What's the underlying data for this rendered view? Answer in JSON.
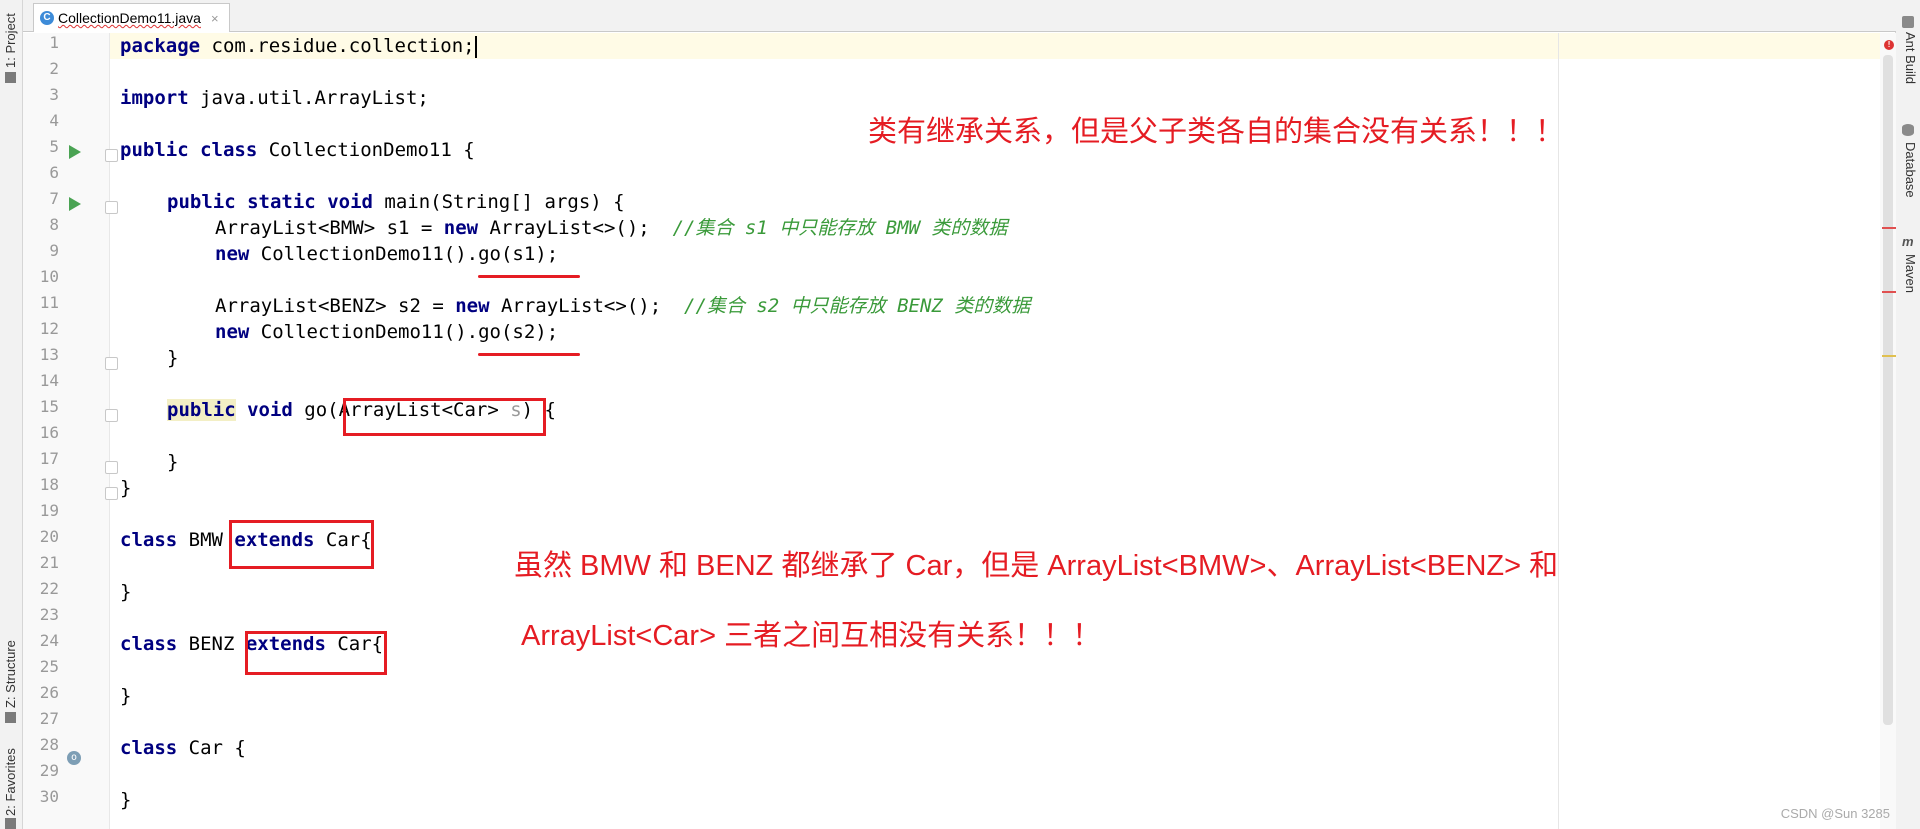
{
  "tab": {
    "filename": "CollectionDemo11.java",
    "close": "×"
  },
  "left_tools": {
    "project": "1: Project",
    "structure": "Z: Structure",
    "favorites": "2: Favorites"
  },
  "right_tools": {
    "ant": "Ant Build",
    "database": "Database",
    "maven": "Maven"
  },
  "line_numbers": [
    "1",
    "2",
    "3",
    "4",
    "5",
    "6",
    "7",
    "8",
    "9",
    "10",
    "11",
    "12",
    "13",
    "14",
    "15",
    "16",
    "17",
    "18",
    "19",
    "20",
    "21",
    "22",
    "23",
    "24",
    "25",
    "26",
    "27",
    "28",
    "29",
    "30"
  ],
  "code": {
    "l1_kw": "package",
    "l1_rest": " com.residue.collection;",
    "l3_kw": "import",
    "l3_rest": " java.util.ArrayList;",
    "l5_kw1": "public",
    "l5_kw2": "class",
    "l5_rest": " CollectionDemo11 {",
    "l7_kw1": "public",
    "l7_kw2": "static",
    "l7_kw3": "void",
    "l7_rest": " main(String[] args) {",
    "l8_a": "ArrayList<BMW> s1 = ",
    "l8_kw": "new",
    "l8_b": " ArrayList<>();  ",
    "l8_cm": "//集合 s1 中只能存放 BMW 类的数据",
    "l9_kw": "new",
    "l9_rest": " CollectionDemo11().go(s1);",
    "l11_a": "ArrayList<BENZ> s2 = ",
    "l11_kw": "new",
    "l11_b": " ArrayList<>();  ",
    "l11_cm": "//集合 s2 中只能存放 BENZ 类的数据",
    "l12_kw": "new",
    "l12_rest": " CollectionDemo11().go(s2);",
    "l13": "}",
    "l15_kw1": "public",
    "l15_kw2": "void",
    "l15_a": " go(ArrayList<Car> ",
    "l15_param": "s",
    "l15_b": ") {",
    "l17": "}",
    "l18": "}",
    "l20_kw1": "class",
    "l20_a": " BMW ",
    "l20_kw2": "extends",
    "l20_b": " Car{",
    "l22": "}",
    "l24_kw1": "class",
    "l24_a": " BENZ ",
    "l24_kw2": "extends",
    "l24_b": " Car{",
    "l26": "}",
    "l28_kw1": "class",
    "l28_a": " Car {",
    "l30": "}"
  },
  "notes": {
    "top": "类有继承关系，但是父子类各自的集合没有关系！！！",
    "mid1": "虽然 BMW 和 BENZ 都继承了 Car，但是 ArrayList<BMW>、ArrayList<BENZ> 和",
    "mid2": "ArrayList<Car> 三者之间互相没有关系！！！"
  },
  "watermark": "CSDN @Sun 3285",
  "colors": {
    "annotation": "#e51c23",
    "keyword": "#000080",
    "comment": "#3a9a3a",
    "run_icon": "#4aa353"
  }
}
